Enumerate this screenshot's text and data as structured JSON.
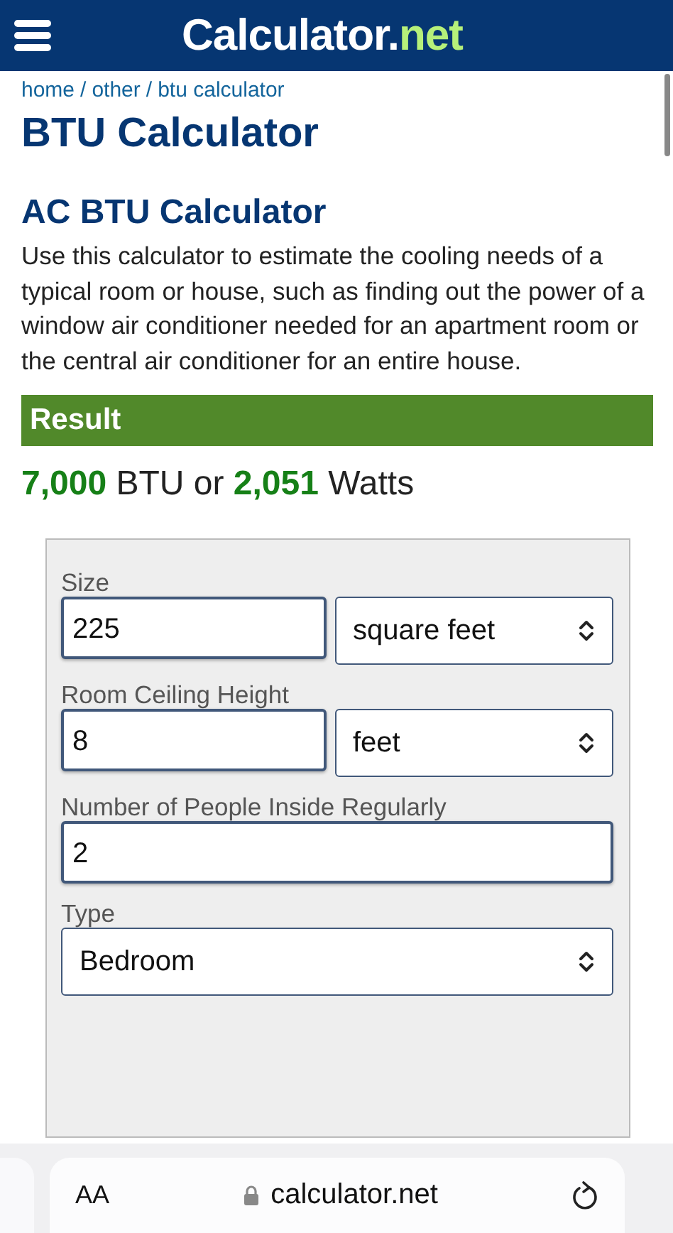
{
  "header": {
    "logo_name": "Calculator.",
    "logo_suffix": "net"
  },
  "breadcrumbs": [
    {
      "label": "home"
    },
    {
      "label": "other"
    },
    {
      "label": "btu calculator"
    }
  ],
  "breadcrumb_separator": "/",
  "page_title": "BTU Calculator",
  "section_title": "AC BTU Calculator",
  "description": "Use this calculator to estimate the cooling needs of a typical room or house, such as finding out the power of a window air conditioner needed for an apartment room or the central air conditioner for an entire house.",
  "result": {
    "heading": "Result",
    "summary": "**7,000** BTU or **2,051** Watts"
  },
  "form": [
    {
      "label": "Size",
      "kind": "input-select",
      "value": "225",
      "unit": "square feet"
    },
    {
      "label": "Room Ceiling Height",
      "kind": "input-select",
      "value": "8",
      "unit": "feet"
    },
    {
      "label": "Number of People Inside Regularly",
      "kind": "input",
      "value": "2"
    },
    {
      "label": "Type",
      "kind": "select",
      "unit": "Bedroom"
    }
  ],
  "browser_bar": {
    "text_size": "AA",
    "address": "calculator.net"
  }
}
